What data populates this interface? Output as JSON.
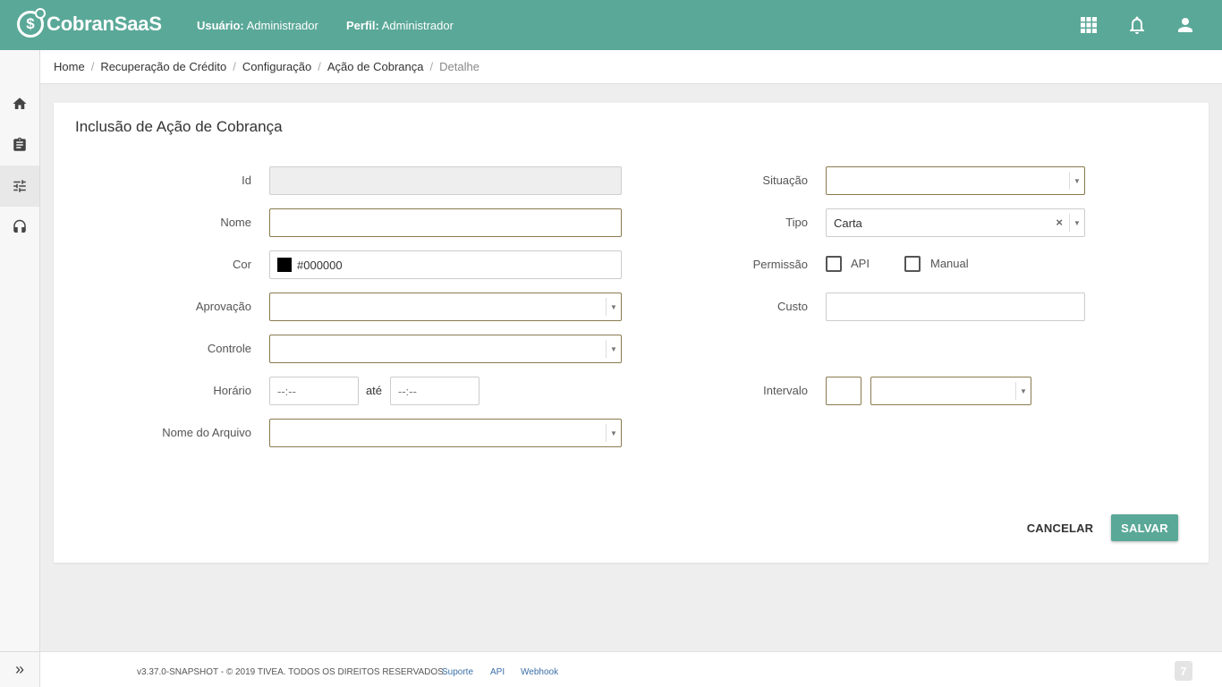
{
  "header": {
    "brand": "CobranSaaS",
    "logo_glyph": "$",
    "user_label": "Usuário:",
    "user_value": "Administrador",
    "profile_label": "Perfil:",
    "profile_value": "Administrador",
    "icons": [
      "apps-grid-icon",
      "bell-icon",
      "user-icon"
    ],
    "color": "#5aa898"
  },
  "sidebar": {
    "items": [
      "home-icon",
      "clipboard-icon",
      "sliders-icon",
      "headset-icon"
    ],
    "active": "sliders-icon",
    "expand_glyph": "»"
  },
  "breadcrumb": {
    "items": [
      "Home",
      "Recuperação de Crédito",
      "Configuração",
      "Ação de Cobrança",
      "Detalhe"
    ],
    "separator": "/"
  },
  "form": {
    "title": "Inclusão de Ação de Cobrança",
    "id": {
      "label": "Id",
      "value": ""
    },
    "nome": {
      "label": "Nome",
      "value": ""
    },
    "cor": {
      "label": "Cor",
      "value": "#000000"
    },
    "aprovacao": {
      "label": "Aprovação",
      "value": ""
    },
    "controle": {
      "label": "Controle",
      "value": ""
    },
    "horario": {
      "label": "Horário",
      "from_placeholder": "--:--",
      "to_label": "até",
      "to_placeholder": "--:--"
    },
    "nome_arquivo": {
      "label": "Nome do Arquivo",
      "value": ""
    },
    "situacao": {
      "label": "Situação",
      "value": ""
    },
    "tipo": {
      "label": "Tipo",
      "value": "Carta",
      "clear": "×"
    },
    "permissao": {
      "label": "Permissão",
      "options": [
        {
          "label": "API",
          "checked": false
        },
        {
          "label": "Manual",
          "checked": false
        }
      ]
    },
    "custo": {
      "label": "Custo",
      "value": ""
    },
    "intervalo": {
      "label": "Intervalo",
      "value": "",
      "unit": ""
    },
    "caret": "▼"
  },
  "actions": {
    "cancel": "CANCELAR",
    "save": "SALVAR"
  },
  "footer": {
    "text": "v3.37.0-SNAPSHOT - © 2019 TIVEA. TODOS OS DIREITOS RESERVADOS.",
    "links": [
      "Suporte",
      "API",
      "Webhook"
    ],
    "logo_glyph": "7"
  }
}
